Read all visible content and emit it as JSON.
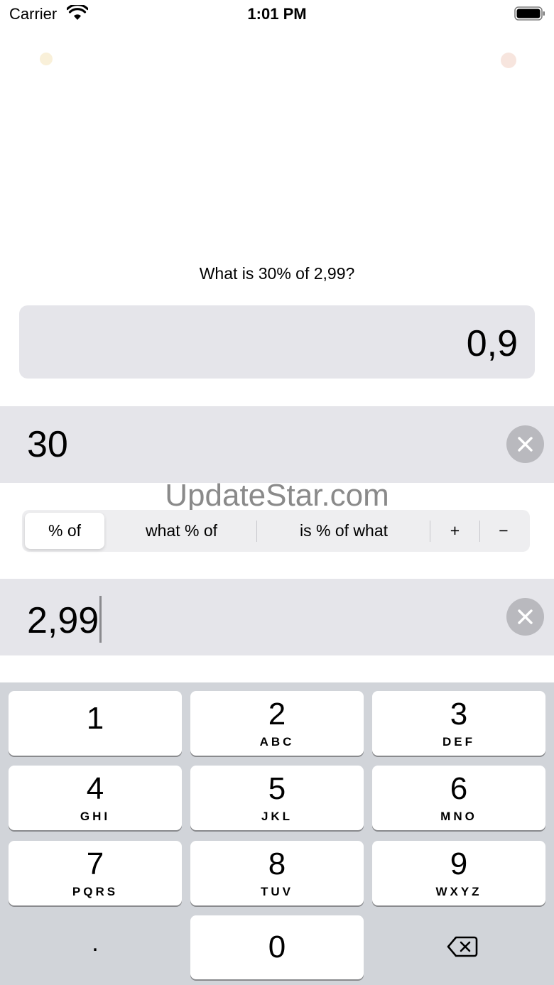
{
  "status_bar": {
    "carrier": "Carrier",
    "time": "1:01 PM"
  },
  "question": "What is 30% of 2,99?",
  "result": "0,9",
  "inputs": {
    "percent_value": "30",
    "base_value": "2,99"
  },
  "watermark": "UpdateStar.com",
  "modes": {
    "selected": "% of",
    "items": [
      "% of",
      "what % of",
      "is % of what",
      "+",
      "−"
    ]
  },
  "keyboard": {
    "keys": [
      {
        "digit": "1",
        "letters": ""
      },
      {
        "digit": "2",
        "letters": "ABC"
      },
      {
        "digit": "3",
        "letters": "DEF"
      },
      {
        "digit": "4",
        "letters": "GHI"
      },
      {
        "digit": "5",
        "letters": "JKL"
      },
      {
        "digit": "6",
        "letters": "MNO"
      },
      {
        "digit": "7",
        "letters": "PQRS"
      },
      {
        "digit": "8",
        "letters": "TUV"
      },
      {
        "digit": "9",
        "letters": "WXYZ"
      },
      {
        "digit": "0",
        "letters": ""
      }
    ],
    "decimal_key": ".",
    "delete_icon": "backspace-icon"
  },
  "colors": {
    "field_background": "#e5e5ea",
    "keyboard_background": "#d1d4d9",
    "clear_button": "#b9b9be"
  }
}
